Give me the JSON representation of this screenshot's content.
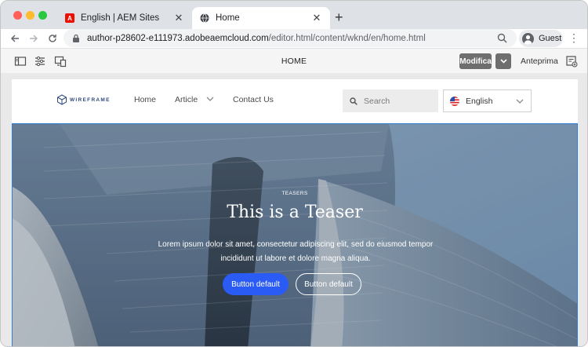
{
  "browser": {
    "tabs": [
      {
        "title": "English | AEM Sites",
        "favicon": "adobe-icon",
        "active": false
      },
      {
        "title": "Home",
        "favicon": "globe-icon",
        "active": true
      }
    ],
    "url_host": "author-p28602-e111973.adobeaemcloud.com",
    "url_path": "/editor.html/content/wknd/en/home.html",
    "profile_label": "Guest"
  },
  "editor": {
    "page_title": "HOME",
    "mode_button": "Modifica",
    "preview_label": "Anteprima"
  },
  "site": {
    "logo_text": "WIREFRAME",
    "nav": [
      {
        "label": "Home"
      },
      {
        "label": "Article"
      },
      {
        "label": "Contact Us"
      }
    ],
    "search_placeholder": "Search",
    "language": "English"
  },
  "teaser": {
    "pretitle": "TEASERS",
    "title": "This is a Teaser",
    "description": "Lorem ipsum dolor sit amet, consectetur adipiscing elit, sed do eiusmod tempor incididunt ut labore et dolore magna aliqua.",
    "primary_button": "Button default",
    "secondary_button": "Button default"
  },
  "colors": {
    "accent_blue": "#2a5bf5",
    "selection_outline": "#2f7fd6",
    "edit_button_bg": "#6e6e6e"
  }
}
